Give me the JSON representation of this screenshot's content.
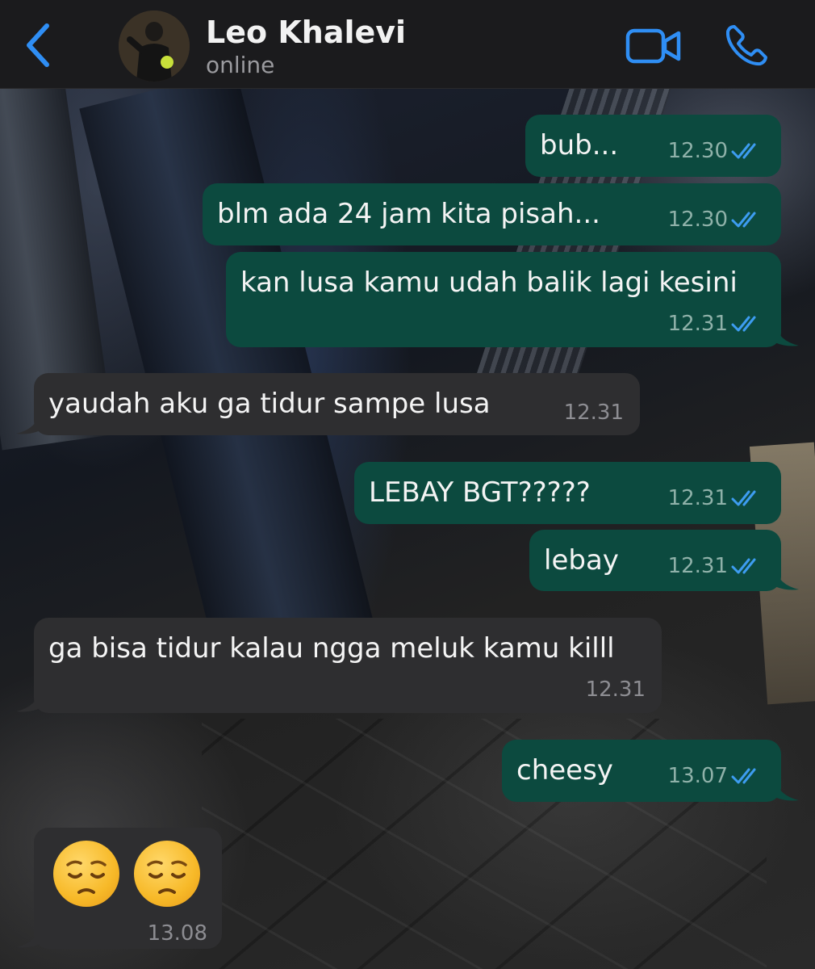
{
  "header": {
    "contact_name": "Leo Khalevi",
    "status": "online",
    "accent_color": "#2f8ef4"
  },
  "messages": [
    {
      "direction": "out",
      "text": "bub...",
      "time": "12.30",
      "read": true
    },
    {
      "direction": "out",
      "text": "blm ada 24 jam kita pisah...",
      "time": "12.30",
      "read": true
    },
    {
      "direction": "out",
      "text": "kan lusa kamu udah balik lagi kesini",
      "time": "12.31",
      "read": true
    },
    {
      "direction": "in",
      "text": "yaudah aku ga tidur sampe lusa",
      "time": "12.31"
    },
    {
      "direction": "out",
      "text": "LEBAY BGT?????",
      "time": "12.31",
      "read": true
    },
    {
      "direction": "out",
      "text": "lebay",
      "time": "12.31",
      "read": true
    },
    {
      "direction": "in",
      "text": "ga bisa tidur kalau ngga meluk kamu killl",
      "time": "12.31"
    },
    {
      "direction": "out",
      "text": "cheesy",
      "time": "13.07",
      "read": true
    },
    {
      "direction": "in",
      "text": "",
      "emoji": [
        "pensive-face",
        "pensive-face"
      ],
      "time": "13.08"
    }
  ],
  "colors": {
    "outgoing_bubble": "#0c4a3f",
    "incoming_bubble": "#2e2e30",
    "read_tick": "#3d9cf0"
  }
}
